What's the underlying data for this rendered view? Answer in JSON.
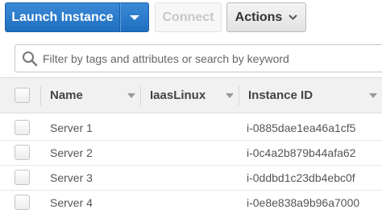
{
  "toolbar": {
    "launch_label": "Launch Instance",
    "connect_label": "Connect",
    "actions_label": "Actions",
    "launch_color": "#1f6fbf"
  },
  "search": {
    "placeholder": "Filter by tags and attributes or search by keyword",
    "value": ""
  },
  "table": {
    "columns": [
      "Name",
      "IaasLinux",
      "Instance ID"
    ],
    "rows": [
      {
        "name": "Server 1",
        "iaaslinux": "",
        "instance_id": "i-0885dae1ea46a1cf5"
      },
      {
        "name": "Server 2",
        "iaaslinux": "",
        "instance_id": "i-0c4a2b879b44afa62"
      },
      {
        "name": "Server 3",
        "iaaslinux": "",
        "instance_id": "i-0ddbd1c23db4ebc0f"
      },
      {
        "name": "Server 4",
        "iaaslinux": "",
        "instance_id": "i-0e8e838a9b96a7000"
      }
    ]
  },
  "icons": {
    "launch_dropdown": "chevron-down-icon",
    "actions_dropdown": "chevron-down-icon",
    "search": "search-icon",
    "column_sort": "caret-down-icon"
  }
}
